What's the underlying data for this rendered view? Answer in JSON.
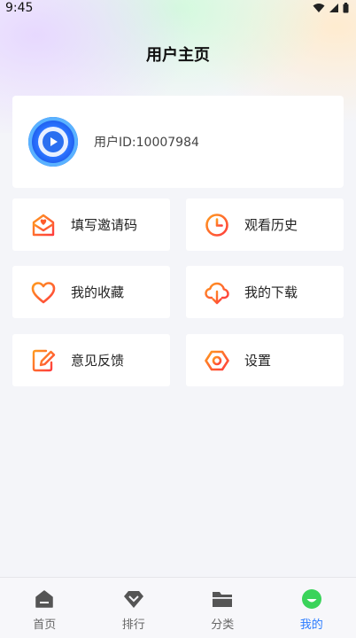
{
  "status_bar": {
    "time": "9:45"
  },
  "header": {
    "title": "用户主页"
  },
  "profile": {
    "user_id": "用户ID:10007984"
  },
  "menu": {
    "invite": "填写邀请码",
    "history": "观看历史",
    "favorites": "我的收藏",
    "downloads": "我的下载",
    "feedback": "意见反馈",
    "settings": "设置"
  },
  "tabs": [
    {
      "label": "首页"
    },
    {
      "label": "排行"
    },
    {
      "label": "分类"
    },
    {
      "label": "我的"
    }
  ],
  "colors": {
    "accent": "#2a7bff",
    "icon_gradient_start": "#ff9a1f",
    "icon_gradient_end": "#ff3d3d"
  }
}
